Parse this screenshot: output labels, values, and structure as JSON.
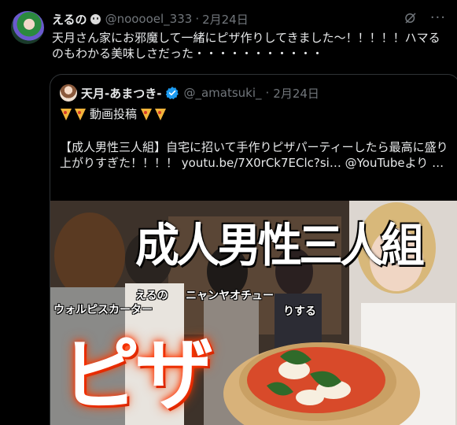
{
  "tweet": {
    "author_name": "えるの",
    "author_handle": "@nooooel_333",
    "date": "2月24日",
    "text": "天月さん家にお邪魔して一緒にピザ作りしてきました〜！！！！！ハマるのもわかる美味しさだった・・・・・・・・・・・"
  },
  "quote": {
    "author_name": "天月-あまつき-",
    "author_handle": "@_amatsuki_",
    "date": "2月24日",
    "line1": "動画投稿",
    "body": "【成人男性三人組】自宅に招いて手作りピザパーティーしたら最高に盛り上がりすぎた！！！！ youtu.be/7X0rCk7EClc?si… @YouTubeより …"
  },
  "media": {
    "title_text": "成人男性三人組",
    "labels": [
      "えるの",
      "ニャンヤオチュー",
      "ウォルピスカーター",
      "りする"
    ],
    "big_text": "ピザ"
  },
  "colors": {
    "background": "#000000",
    "text": "#e7e9ea",
    "muted": "#71767b",
    "border": "#2f3336",
    "verified": "#1d9bf0"
  }
}
